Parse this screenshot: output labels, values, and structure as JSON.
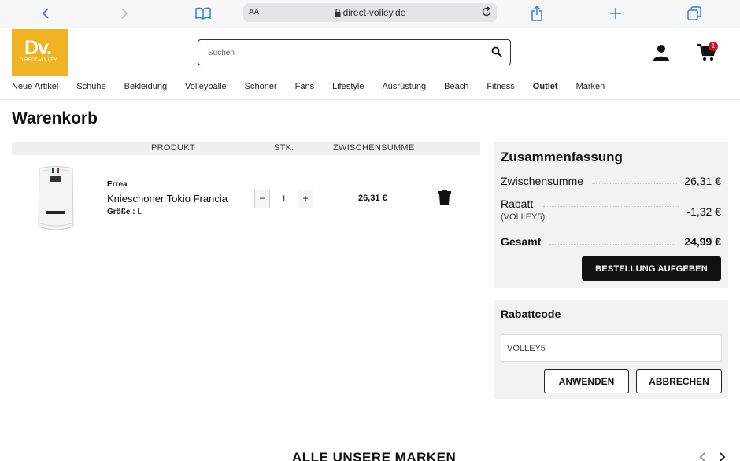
{
  "browser": {
    "reader_label": "AA",
    "url": "direct-volley.de"
  },
  "header": {
    "logo_text": "Dv.",
    "logo_sub": "DIRECT-VOLLEY",
    "search_placeholder": "Suchen",
    "cart_count": "1"
  },
  "nav": {
    "items": [
      "Neue Artikel",
      "Schuhe",
      "Bekleidung",
      "Volleybälle",
      "Schoner",
      "Fans",
      "Lifestyle",
      "Ausrüstung",
      "Beach",
      "Fitness",
      "Outlet",
      "Marken"
    ]
  },
  "page": {
    "title": "Warenkorb"
  },
  "cart": {
    "columns": {
      "product": "PRODUKT",
      "qty": "STK.",
      "subtotal": "ZWISCHENSUMME"
    },
    "item": {
      "brand": "Errea",
      "name": "Knieschoner Tokio Francia",
      "size_label": "Größe :",
      "size_value": "L",
      "quantity": "1",
      "minus": "−",
      "plus": "+",
      "line_total": "26,31 €"
    }
  },
  "summary": {
    "title": "Zusammenfassung",
    "subtotal_label": "Zwischensumme",
    "subtotal_value": "26,31 €",
    "discount_label": "Rabatt",
    "discount_code": "(VOLLEY5)",
    "discount_value": "-1,32 €",
    "total_label": "Gesamt",
    "total_value": "24,99 €",
    "order_button": "BESTELLUNG AUFGEBEN"
  },
  "coupon": {
    "title": "Rabattcode",
    "value": "VOLLEY5",
    "apply_button": "ANWENDEN",
    "cancel_button": "ABBRECHEN"
  },
  "brands": {
    "title": "ALLE UNSERE MARKEN"
  },
  "colors": {
    "brand_yellow": "#f0b323",
    "safari_blue": "#2f7cf6",
    "badge_red": "#d0101c"
  }
}
